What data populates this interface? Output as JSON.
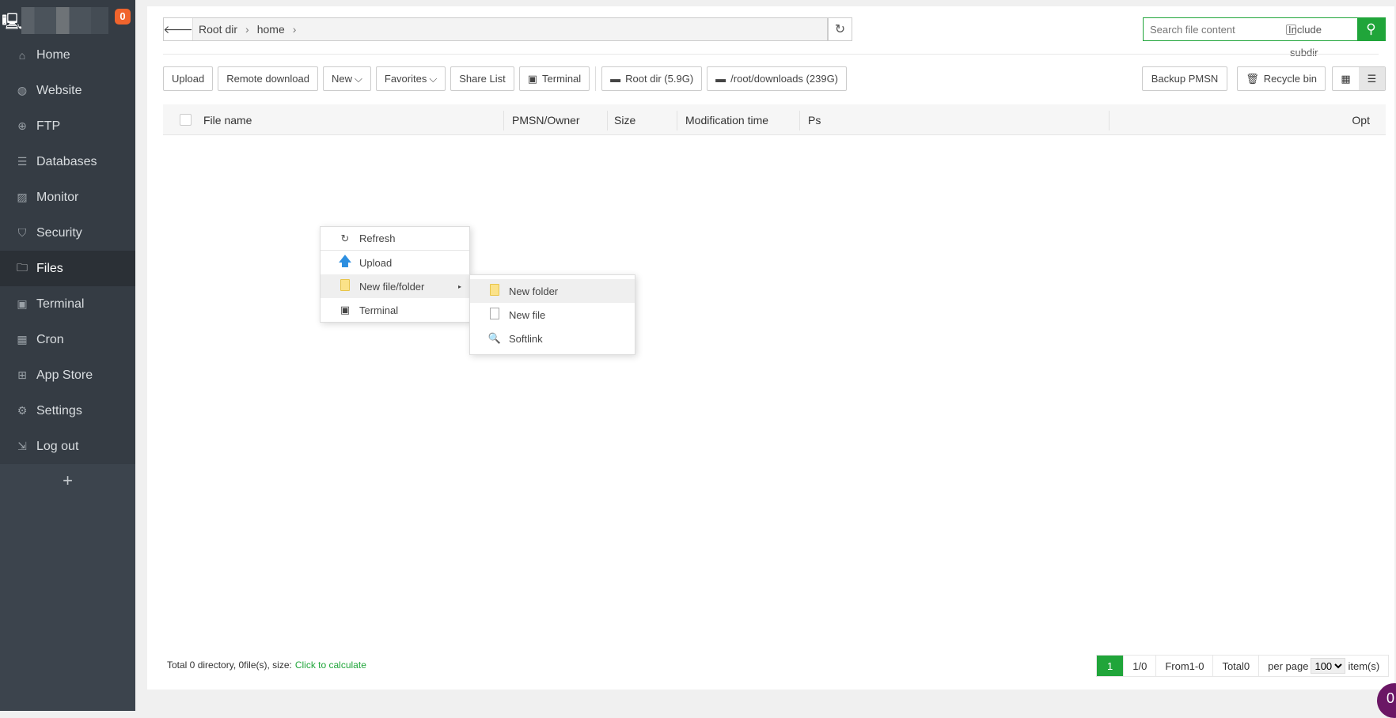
{
  "sidebar": {
    "badge": "0",
    "items": [
      {
        "label": "Home",
        "icon": "home-icon"
      },
      {
        "label": "Website",
        "icon": "globe-icon"
      },
      {
        "label": "FTP",
        "icon": "ftp-icon"
      },
      {
        "label": "Databases",
        "icon": "database-icon"
      },
      {
        "label": "Monitor",
        "icon": "monitor-icon"
      },
      {
        "label": "Security",
        "icon": "shield-icon"
      },
      {
        "label": "Files",
        "icon": "folder-icon",
        "active": true
      },
      {
        "label": "Terminal",
        "icon": "terminal-icon"
      },
      {
        "label": "Cron",
        "icon": "calendar-icon"
      },
      {
        "label": "App Store",
        "icon": "grid-icon"
      },
      {
        "label": "Settings",
        "icon": "gear-icon"
      },
      {
        "label": "Log out",
        "icon": "logout-icon"
      }
    ],
    "add": "+"
  },
  "breadcrumb": {
    "segments": [
      "Root dir",
      "home"
    ]
  },
  "search": {
    "placeholder": "Search file content",
    "include_label": "Include",
    "subdir_label": "subdir"
  },
  "toolbar": {
    "upload": "Upload",
    "remote_download": "Remote download",
    "new": "New",
    "favorites": "Favorites",
    "share_list": "Share List",
    "terminal": "Terminal",
    "root_dir": "Root dir (5.9G)",
    "downloads": "/root/downloads (239G)",
    "backup_pmsn": "Backup PMSN",
    "recycle_bin": "Recycle bin"
  },
  "table": {
    "columns": [
      "File name",
      "PMSN/Owner",
      "Size",
      "Modification time",
      "Ps",
      "Opt"
    ]
  },
  "footer": {
    "stat": "Total 0 directory, 0file(s), size:",
    "calc_link": "Click to calculate"
  },
  "pager": {
    "current": "1",
    "pages": "1/0",
    "range": "From1-0",
    "total": "Total0",
    "per_page_label": "per page",
    "per_page": "100",
    "items_label": "item(s)"
  },
  "context_menu": {
    "items": [
      "Refresh",
      "Upload",
      "New file/folder",
      "Terminal"
    ],
    "submenu": [
      "New folder",
      "New file",
      "Softlink"
    ]
  },
  "chat_badge": "0",
  "colors": {
    "accent": "#20a53a",
    "sidebar": "#3c444d",
    "badge": "#f0642d"
  }
}
